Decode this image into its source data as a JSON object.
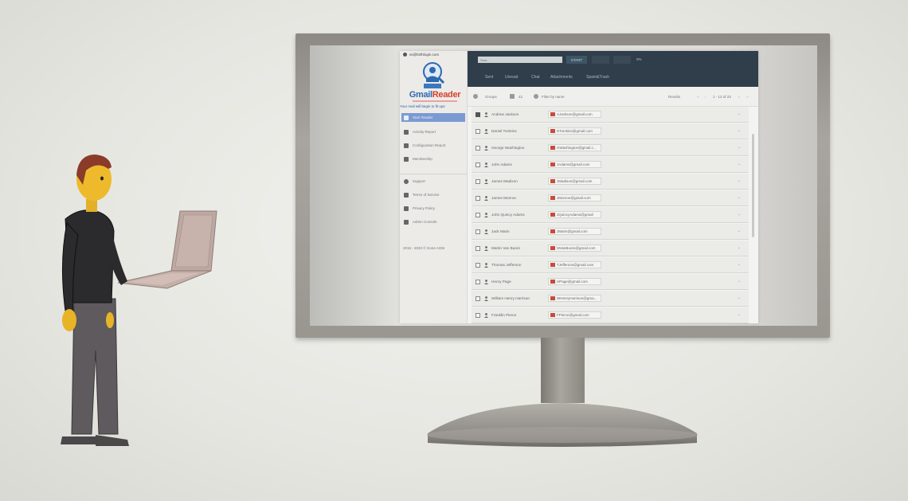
{
  "colors": {
    "accent": "#7b9ad2",
    "topbar": "#2f3e4a",
    "logo_blue": "#2d69b1",
    "logo_red": "#d8402c"
  },
  "sidebar": {
    "account": "ss@birthlogin.com",
    "logo_left": "Gmail",
    "logo_right": "Reader",
    "tagline": "Your mail will begin to fit ups",
    "items": [
      {
        "label": "Start Reader",
        "icon": "play-icon",
        "active": true
      },
      {
        "label": "Activity Report",
        "icon": "report-icon"
      },
      {
        "label": "Configuration Report",
        "icon": "shield-icon"
      },
      {
        "label": "Membership",
        "icon": "card-icon"
      },
      {
        "label": "Support",
        "icon": "help-icon"
      },
      {
        "label": "Terms of Service",
        "icon": "gavel-icon"
      },
      {
        "label": "Privacy Policy",
        "icon": "lock-icon"
      },
      {
        "label": "Admin Console",
        "icon": "tool-icon"
      }
    ],
    "copyright": "2015 - 2020 © Gone AGM"
  },
  "topbar": {
    "search_placeholder": "Sear...",
    "start_label": "START",
    "percent": "0%",
    "tabs": [
      "Sent",
      "Unread",
      "Chat",
      "Attachments",
      "Spam&Trash"
    ]
  },
  "toolbar": {
    "group_label": "Groups",
    "count": "42",
    "filter_placeholder": "Filter by name",
    "pager_label": "Results",
    "range": "1 - 13 of 23"
  },
  "rows": [
    {
      "name": "Andrew Jackson",
      "email": "AJackson@gmail.com",
      "checked": true
    },
    {
      "name": "Daniel Tomkins",
      "email": "DTomkins@gmail.com",
      "checked": false
    },
    {
      "name": "George Washington",
      "email": "GWashington@gmail.c...",
      "checked": false
    },
    {
      "name": "John Adams",
      "email": "JAdams@gmail.com",
      "checked": false
    },
    {
      "name": "James Madison",
      "email": "JMadison@gmail.com",
      "checked": false
    },
    {
      "name": "James Monroe",
      "email": "JMonroe@gmail.com",
      "checked": false
    },
    {
      "name": "John Quincy Adams",
      "email": "JQuincyAdams@gmail",
      "checked": false
    },
    {
      "name": "Jack Marin",
      "email": "JMarin@gmail.com",
      "checked": false
    },
    {
      "name": "Martin Van Buren",
      "email": "MVanBuren@gmail.com",
      "checked": false
    },
    {
      "name": "Thomas Jefferson",
      "email": "TJefferson@gmail.com",
      "checked": false
    },
    {
      "name": "Henry Page",
      "email": "HPage@gmail.com",
      "checked": false
    },
    {
      "name": "William Henry Harrison",
      "email": "WHenryHarrison@gma...",
      "checked": false
    },
    {
      "name": "Franklin Pierce",
      "email": "FPierce@gmail.com",
      "checked": false
    }
  ]
}
